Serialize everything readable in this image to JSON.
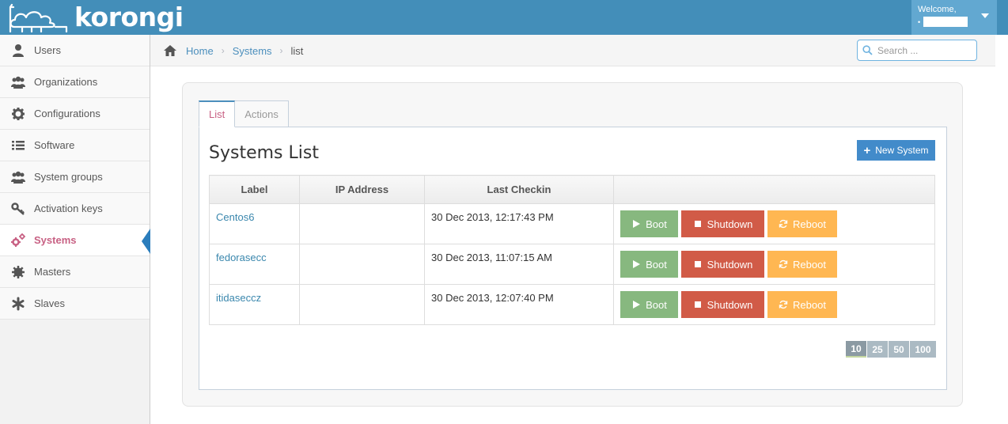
{
  "app": {
    "logo_text": "korongi"
  },
  "user": {
    "welcome": "Welcome,",
    "name": ""
  },
  "sidebar": {
    "items": [
      {
        "label": "Users",
        "icon": "user-icon",
        "active": false
      },
      {
        "label": "Organizations",
        "icon": "group-icon",
        "active": false
      },
      {
        "label": "Configurations",
        "icon": "cog-icon",
        "active": false
      },
      {
        "label": "Software",
        "icon": "list-icon",
        "active": false
      },
      {
        "label": "System groups",
        "icon": "group-icon",
        "active": false
      },
      {
        "label": "Activation keys",
        "icon": "key-icon",
        "active": false
      },
      {
        "label": "Systems",
        "icon": "cogs-icon",
        "active": true
      },
      {
        "label": "Masters",
        "icon": "gear-icon",
        "active": false
      },
      {
        "label": "Slaves",
        "icon": "asterisk-icon",
        "active": false
      }
    ]
  },
  "breadcrumb": {
    "home": "Home",
    "section": "Systems",
    "current": "list"
  },
  "search": {
    "placeholder": "Search ..."
  },
  "tabs": [
    {
      "label": "List",
      "active": true
    },
    {
      "label": "Actions",
      "active": false
    }
  ],
  "panel": {
    "title": "Systems List",
    "new_button": "New System"
  },
  "table": {
    "headers": [
      "Label",
      "IP Address",
      "Last Checkin",
      ""
    ],
    "rows": [
      {
        "label": "Centos6",
        "ip": "",
        "last_checkin": "30 Dec 2013, 12:17:43 PM"
      },
      {
        "label": "fedorasecc",
        "ip": "",
        "last_checkin": "30 Dec 2013, 11:07:15 AM"
      },
      {
        "label": "itidaseccz",
        "ip": "",
        "last_checkin": "30 Dec 2013, 12:07:40 PM"
      }
    ],
    "actions": {
      "boot": "Boot",
      "shutdown": "Shutdown",
      "reboot": "Reboot"
    }
  },
  "pagination": {
    "options": [
      "10",
      "25",
      "50",
      "100"
    ],
    "selected": "10"
  },
  "colors": {
    "header": "#438eb9",
    "active_nav": "#c86184",
    "link": "#4c8fbd",
    "boot": "#87b87f",
    "shutdown": "#d15b47",
    "reboot": "#ffb752",
    "new_button": "#428bca"
  }
}
